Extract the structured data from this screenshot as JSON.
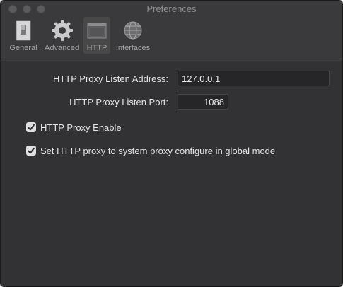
{
  "window": {
    "title": "Preferences"
  },
  "toolbar": {
    "tabs": [
      {
        "label": "General",
        "icon": "switch-icon",
        "selected": false
      },
      {
        "label": "Advanced",
        "icon": "gear-icon",
        "selected": false
      },
      {
        "label": "HTTP",
        "icon": "window-icon",
        "selected": true
      },
      {
        "label": "Interfaces",
        "icon": "network-globe-icon",
        "selected": false
      }
    ]
  },
  "http": {
    "listen_address_label": "HTTP Proxy Listen Address:",
    "listen_address_value": "127.0.0.1",
    "listen_port_label": "HTTP Proxy Listen Port:",
    "listen_port_value": "1088",
    "enable_label": "HTTP Proxy Enable",
    "enable_checked": true,
    "system_proxy_label": "Set HTTP proxy to system proxy configure in global mode",
    "system_proxy_checked": true
  },
  "colors": {
    "window_bg": "#323234",
    "toolbar_bg": "#3a3a3c",
    "checkbox_fill": "#dfdfe1"
  }
}
